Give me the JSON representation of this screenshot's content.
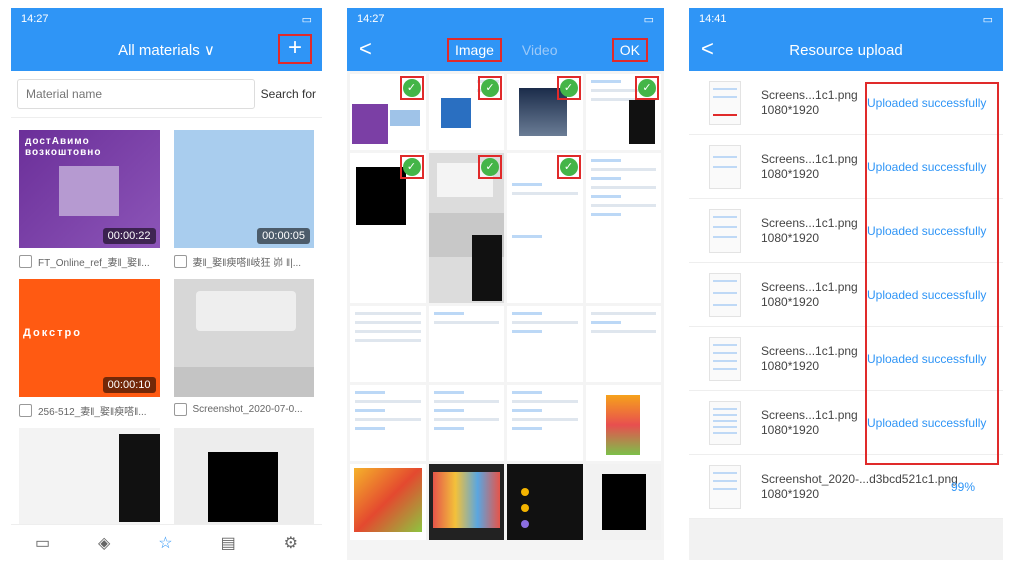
{
  "screen1": {
    "status_time": "14:27",
    "title": "All materials ∨",
    "add_label": "+",
    "search_placeholder": "Material name",
    "search_button": "Search for",
    "items": [
      {
        "duration": "00:00:22",
        "name": "FT_Online_ref_妻‖_娶‖..."
      },
      {
        "duration": "00:00:05",
        "name": "妻‖_娶‖瘐嗒‖岐狂 峁 ‖|..."
      },
      {
        "duration": "00:00:10",
        "name": "256-512_妻‖_娶‖瘐嗒‖..."
      },
      {
        "duration": "",
        "name": "Screenshot_2020-07-0..."
      }
    ],
    "thumb_text_1": "достАвимо\nвозкоштовно",
    "thumb_text_3": "Докстро",
    "nav_icons": [
      "monitor-icon",
      "layers-icon",
      "star-icon",
      "document-icon",
      "settings-icon"
    ]
  },
  "screen2": {
    "status_time": "14:27",
    "back": "<",
    "tab_image": "Image",
    "tab_video": "Video",
    "ok_label": "OK",
    "check_mark": "✓"
  },
  "screen3": {
    "status_time": "14:41",
    "back": "<",
    "title": "Resource upload",
    "files": [
      {
        "name": "Screens...1c1.png",
        "size": "1080*1920",
        "status": "Uploaded successfully"
      },
      {
        "name": "Screens...1c1.png",
        "size": "1080*1920",
        "status": "Uploaded successfully"
      },
      {
        "name": "Screens...1c1.png",
        "size": "1080*1920",
        "status": "Uploaded successfully"
      },
      {
        "name": "Screens...1c1.png",
        "size": "1080*1920",
        "status": "Uploaded successfully"
      },
      {
        "name": "Screens...1c1.png",
        "size": "1080*1920",
        "status": "Uploaded successfully"
      },
      {
        "name": "Screens...1c1.png",
        "size": "1080*1920",
        "status": "Uploaded successfully"
      },
      {
        "name": "Screenshot_2020-...d3bcd521c1.png",
        "size": "1080*1920",
        "status": "99%"
      }
    ]
  },
  "colors": {
    "accent": "#2f95f6",
    "highlight": "#e02a2a",
    "check": "#44b548"
  }
}
